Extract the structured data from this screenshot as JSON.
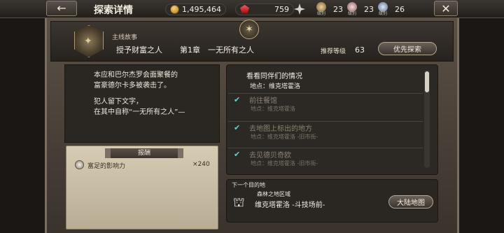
{
  "topbar": {
    "title": "探索详情",
    "gold": "1,495,464",
    "gems": "759",
    "badges": [
      {
        "icon": "crest-gold-icon",
        "level_label": "级别",
        "value": "23",
        "color": "#c8a060"
      },
      {
        "icon": "crest-pink-icon",
        "level_label": "级别",
        "value": "23",
        "color": "#d09a9a"
      },
      {
        "icon": "crest-blue-icon",
        "level_label": "级别",
        "value": "26",
        "color": "#9ab0d0"
      }
    ]
  },
  "header": {
    "category": "主线故事",
    "quest_name": "授予财富之人",
    "chapter": "第1章　一无所有之人",
    "recommend_label": "推荐等级",
    "recommend_value": "63",
    "priority_button": "优先探索"
  },
  "story": {
    "para1_line1": "本应和巴尔杰罗会面聚餐的",
    "para1_line2": "富豪德尔卡多被袭击了。",
    "para2_line1": "犯人留下文字，",
    "para2_line2": "在其中自称“一无所有之人”—"
  },
  "reward": {
    "title": "报酬",
    "item_name": "富足的影响力",
    "item_qty": "×240"
  },
  "objectives": {
    "main_title": "看看同伴们的情况",
    "main_location": "地点：维克塔霍洛",
    "items": [
      {
        "name": "前往餐馆",
        "location": "地点：维克塔霍洛"
      },
      {
        "name": "去地图上标出的地方",
        "location": "地点：维克塔霍洛 -旧市街-"
      },
      {
        "name": "去见德贝奇欧",
        "location": "地点：维克塔霍洛 -旧市街-"
      }
    ]
  },
  "next": {
    "label": "下一个目的地",
    "region": "森林之地区域",
    "destination": "维克塔霍洛 -斗技场前-",
    "map_button": "大陆地图"
  }
}
